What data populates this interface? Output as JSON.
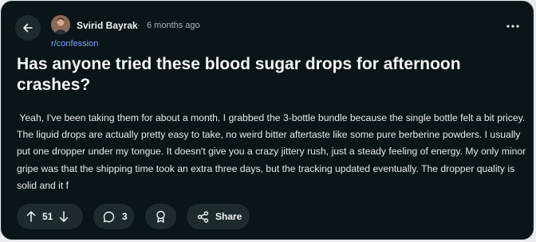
{
  "post": {
    "author": "Svirid Bayrak",
    "separator": "·",
    "time_ago": "6 months ago",
    "subreddit": "r/confession",
    "title": "Has anyone tried these blood sugar drops for afternoon crashes?",
    "body": " Yeah, I've been taking them for about a month. I grabbed the 3-bottle bundle because the single bottle felt a bit pricey. The liquid drops are actually pretty easy to take, no weird bitter aftertaste like some pure berberine powders. I usually put one dropper under my tongue. It doesn't give you a crazy jittery rush, just a steady feeling of energy. My only minor gripe was that the shipping time took an extra three days, but the tracking updated eventually. The dropper quality is solid and it f"
  },
  "actions": {
    "vote_count": "51",
    "comment_count": "3",
    "share_label": "Share"
  },
  "icons": {
    "back": "arrow-left-icon",
    "more": "more-horizontal-icon",
    "upvote": "arrow-up-icon",
    "downvote": "arrow-down-icon",
    "comment": "comment-bubble-icon",
    "award": "award-icon",
    "share": "share-icon"
  },
  "colors": {
    "background": "#0b1418",
    "button": "#1f2a2f",
    "text": "#f2f4f5",
    "meta": "#a8b5bb",
    "subreddit_link": "#7aa5ff"
  }
}
